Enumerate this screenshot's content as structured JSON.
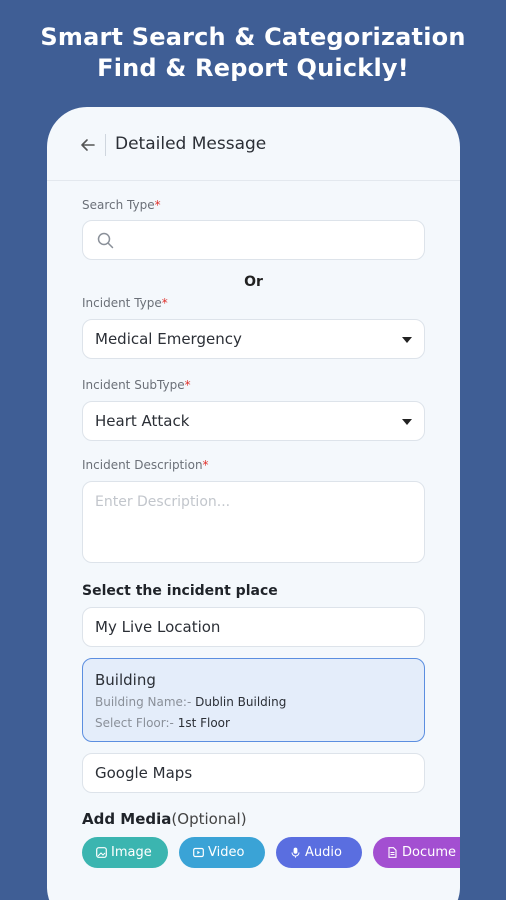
{
  "promo": {
    "line1": "Smart Search & Categorization",
    "line2": "Find & Report Quickly!"
  },
  "header": {
    "title": "Detailed Message",
    "back_icon": "arrow-left-icon"
  },
  "search_type": {
    "label": "Search Type",
    "required_mark": "*",
    "icon": "search-icon",
    "value": ""
  },
  "or_text": "Or",
  "incident_type": {
    "label": "Incident Type",
    "required_mark": "*",
    "value": "Medical Emergency"
  },
  "incident_subtype": {
    "label": "Incident SubType",
    "required_mark": "*",
    "value": "Heart Attack"
  },
  "incident_description": {
    "label": "Incident Description",
    "required_mark": "*",
    "placeholder": "Enter Description..."
  },
  "incident_place": {
    "section_title": "Select the incident place",
    "live_location": "My Live Location",
    "building": {
      "title": "Building",
      "name_label": "Building Name:-",
      "name_value": "Dublin Building",
      "floor_label": "Select Floor:-",
      "floor_value": "1st Floor"
    },
    "google_maps": "Google Maps"
  },
  "media": {
    "title": "Add Media",
    "optional": "(Optional)",
    "chips": [
      {
        "label": "Image",
        "icon": "image-icon",
        "color": "#3bb5b0"
      },
      {
        "label": "Video",
        "icon": "video-icon",
        "color": "#3aa3d6"
      },
      {
        "label": "Audio",
        "icon": "microphone-icon",
        "color": "#5a6ee0"
      },
      {
        "label": "Docume",
        "icon": "document-icon",
        "color": "#a34fd1"
      }
    ]
  },
  "colors": {
    "background": "#3f5e95",
    "required": "#e0302a",
    "selected_border": "#5b8ee0",
    "selected_fill": "#e4edfa"
  }
}
